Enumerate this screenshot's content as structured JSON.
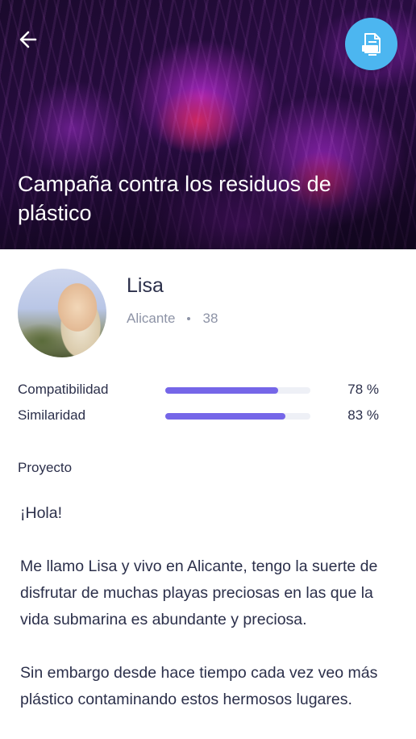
{
  "header": {
    "title": "Campaña contra los residuos de plástico",
    "back_icon": "arrow-left-icon",
    "action_icon": "document-icon",
    "action_color": "#4cb6f0"
  },
  "profile": {
    "name": "Lisa",
    "city": "Alicante",
    "age": "38"
  },
  "stats": [
    {
      "label": "Compatibilidad",
      "percent": 78,
      "value_text": "78 %"
    },
    {
      "label": "Similaridad",
      "percent": 83,
      "value_text": "83 %"
    }
  ],
  "stat_bar_color": "#7566e8",
  "project": {
    "heading": "Proyecto",
    "paragraphs": [
      "¡Hola!",
      "Me llamo Lisa y vivo en Alicante, tengo la suerte de disfrutar de muchas playas preciosas en las que la vida submarina es abundante y preciosa.",
      "Sin embargo desde hace tiempo cada vez veo más plástico contaminando estos hermosos lugares."
    ]
  }
}
